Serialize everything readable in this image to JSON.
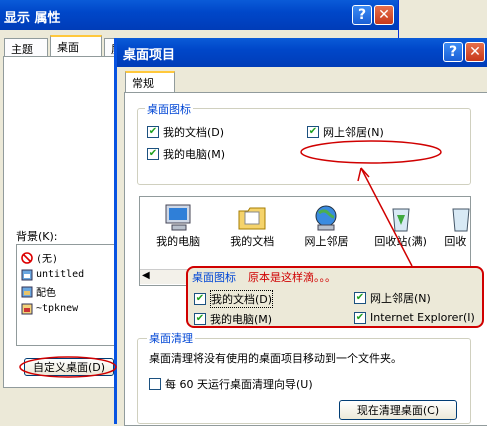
{
  "bg_window": {
    "title": "显示 属性",
    "tabs": [
      "主题",
      "桌面",
      "屏"
    ],
    "background_label": "背景(K):",
    "background_items": [
      "(无)",
      "untitled",
      "配色",
      "~tpknew"
    ],
    "customize_button": "自定义桌面(D)"
  },
  "dialog": {
    "title": "桌面项目",
    "tab": "常规",
    "icons_group": {
      "title": "桌面图标",
      "items": [
        {
          "label": "我的文档(D)",
          "checked": true
        },
        {
          "label": "网上邻居(N)",
          "checked": true
        },
        {
          "label": "我的电脑(M)",
          "checked": true
        }
      ]
    },
    "preview_icons": [
      "我的电脑",
      "我的文档",
      "网上邻居",
      "回收站(满)",
      "回收"
    ],
    "cleanup_group": {
      "title": "桌面清理",
      "description": "桌面清理将没有使用的桌面项目移动到一个文件夹。",
      "checkbox_label": "每 60 天运行桌面清理向导(U)",
      "button_label": "现在清理桌面(C)"
    }
  },
  "annotation": {
    "group_title": "桌面图标",
    "note": "原本是这样滴。。。",
    "items": [
      {
        "label": "我的文档(D)",
        "checked": true
      },
      {
        "label": "网上邻居(N)",
        "checked": true
      },
      {
        "label": "我的电脑(M)",
        "checked": true
      },
      {
        "label": "Internet Explorer(I)",
        "checked": true
      }
    ]
  },
  "colors": {
    "accent_red": "#d00000",
    "title_blue": "#0047c9",
    "group_blue": "#0046d5"
  }
}
